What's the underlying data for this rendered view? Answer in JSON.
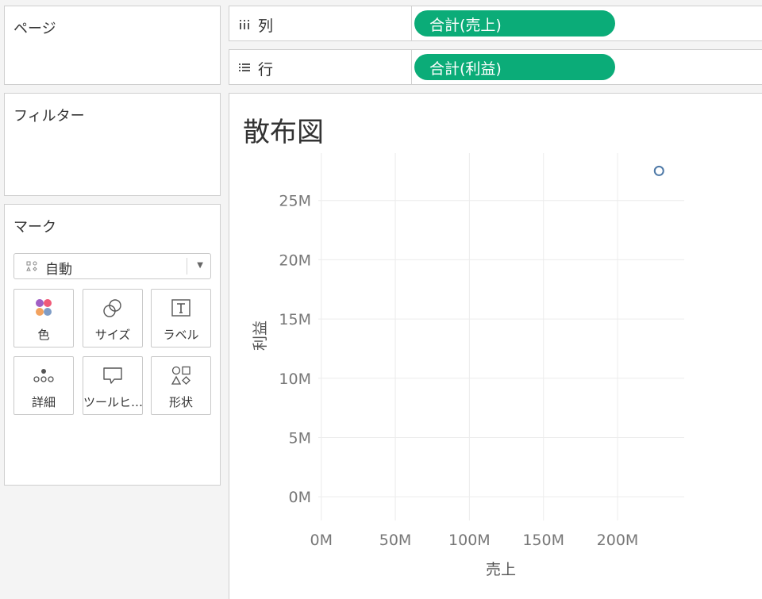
{
  "pages_panel": {
    "title": "ページ"
  },
  "filters_panel": {
    "title": "フィルター"
  },
  "marks_panel": {
    "title": "マーク",
    "mark_type": {
      "selected": "自動",
      "icon": "auto-mark-icon"
    },
    "cards": [
      {
        "label": "色",
        "icon": "color-icon"
      },
      {
        "label": "サイズ",
        "icon": "size-icon"
      },
      {
        "label": "ラベル",
        "icon": "label-icon"
      },
      {
        "label": "詳細",
        "icon": "detail-icon"
      },
      {
        "label": "ツールヒ…",
        "icon": "tooltip-icon"
      },
      {
        "label": "形状",
        "icon": "shape-icon"
      }
    ]
  },
  "shelves": {
    "columns": {
      "label": "列",
      "icon": "columns-icon",
      "pill": "合計(売上)"
    },
    "rows": {
      "label": "行",
      "icon": "rows-icon",
      "pill": "合計(利益)"
    }
  },
  "view": {
    "title": "散布図"
  },
  "colors": {
    "pill": "#0bac78",
    "mark": "#4e79a7",
    "color_dots": [
      "#a05ec4",
      "#f05a78",
      "#f2a25f",
      "#7e9cc6"
    ]
  },
  "chart_data": {
    "type": "scatter",
    "xlabel": "売上",
    "ylabel": "利益",
    "xlim": [
      -2000000,
      245000000
    ],
    "ylim": [
      -2000000,
      29000000
    ],
    "x_ticks": [
      0,
      50000000,
      100000000,
      150000000,
      200000000
    ],
    "x_tick_labels": [
      "0M",
      "50M",
      "100M",
      "150M",
      "200M"
    ],
    "y_ticks": [
      0,
      5000000,
      10000000,
      15000000,
      20000000,
      25000000
    ],
    "y_tick_labels": [
      "0M",
      "5M",
      "10M",
      "15M",
      "20M",
      "25M"
    ],
    "grid": true,
    "points": [
      {
        "x": 228000000,
        "y": 27500000
      }
    ]
  }
}
